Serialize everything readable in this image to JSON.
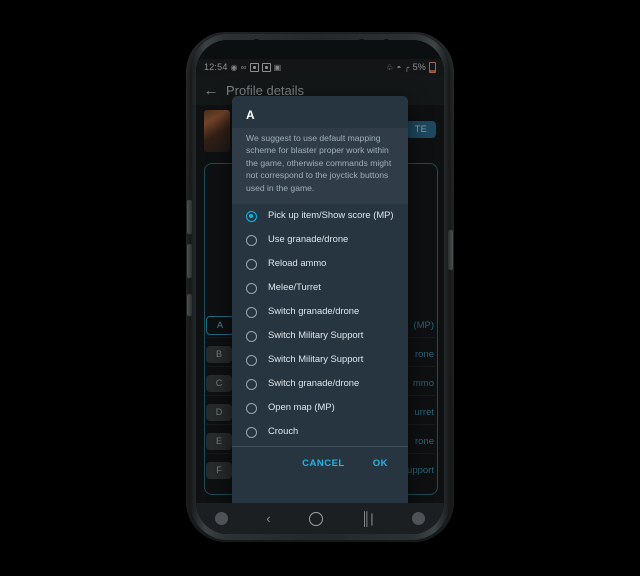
{
  "statusbar": {
    "time": "12:54",
    "left_icons": [
      "at-icon",
      "infinity-icon",
      "app-square-icon",
      "app-square-icon-2",
      "image-icon"
    ],
    "bluetooth_icon": "bluetooth-icon",
    "wifi_icon": "wifi-icon",
    "signal_icon": "signal-bars-icon",
    "battery_percent": "5%",
    "battery_icon": "battery-icon"
  },
  "appbar": {
    "back_icon": "back-arrow-icon",
    "title": "Profile details"
  },
  "background": {
    "update_button": "TE",
    "thumbnail": "game-thumbnail",
    "key_rows": [
      {
        "key": "A",
        "value": "(MP)",
        "selected": true
      },
      {
        "key": "B",
        "value": "rone",
        "selected": false
      },
      {
        "key": "C",
        "value": "mmo",
        "selected": false
      },
      {
        "key": "D",
        "value": "urret",
        "selected": false
      },
      {
        "key": "E",
        "value": "rone",
        "selected": false
      },
      {
        "key": "F",
        "value": "Switch Military Support",
        "selected": false
      }
    ]
  },
  "dialog": {
    "title": "A",
    "message": "We suggest to use default mapping scheme for blaster proper work within the game, otherwise commands might not correspond to the joyctick buttons used in the game.",
    "options": [
      {
        "label": "Pick up item/Show score (MP)",
        "selected": true
      },
      {
        "label": "Use granade/drone",
        "selected": false
      },
      {
        "label": "Reload ammo",
        "selected": false
      },
      {
        "label": "Melee/Turret",
        "selected": false
      },
      {
        "label": "Switch granade/drone",
        "selected": false
      },
      {
        "label": "Switch Military Support",
        "selected": false
      },
      {
        "label": "Switch Military Support",
        "selected": false
      },
      {
        "label": "Switch granade/drone",
        "selected": false
      },
      {
        "label": "Open map (MP)",
        "selected": false
      },
      {
        "label": "Crouch",
        "selected": false
      }
    ],
    "cancel_label": "CANCEL",
    "ok_label": "OK",
    "accent_color": "#10b4e8"
  },
  "navbar": {
    "left_icon": "assistant-icon",
    "back_icon": "back-chevron-icon",
    "home_icon": "home-circle-icon",
    "recents_icon": "recents-icon",
    "right_icon": "keyboard-toggle-icon"
  }
}
